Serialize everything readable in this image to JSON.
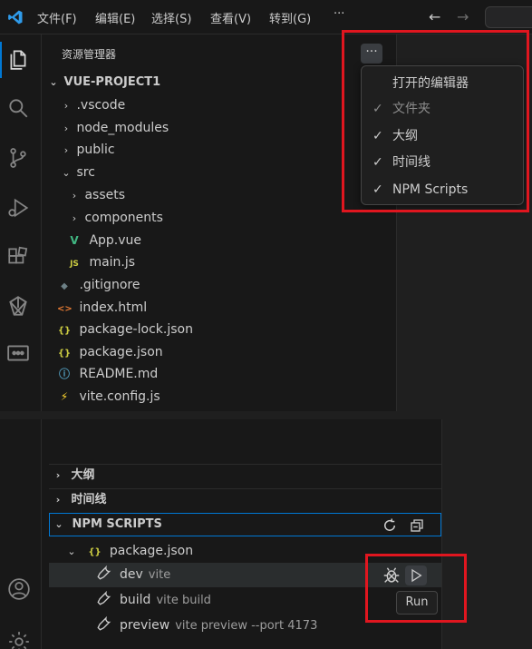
{
  "titlebar": {
    "menu": [
      "文件(F)",
      "编辑(E)",
      "选择(S)",
      "查看(V)",
      "转到(G)"
    ],
    "more": "···",
    "back": "←",
    "forward": "→"
  },
  "explorer": {
    "title": "资源管理器",
    "more": "···",
    "root": "VUE-PROJECT1",
    "items": [
      {
        "label": ".vscode",
        "kind": "folder",
        "expanded": false
      },
      {
        "label": "node_modules",
        "kind": "folder",
        "expanded": false
      },
      {
        "label": "public",
        "kind": "folder",
        "expanded": false
      },
      {
        "label": "src",
        "kind": "folder",
        "expanded": true
      },
      {
        "label": "assets",
        "kind": "folder",
        "expanded": false
      },
      {
        "label": "components",
        "kind": "folder",
        "expanded": false
      },
      {
        "label": "App.vue",
        "kind": "vue",
        "icon": "V"
      },
      {
        "label": "main.js",
        "kind": "js",
        "icon": "JS"
      },
      {
        "label": ".gitignore",
        "kind": "git",
        "icon": "◆"
      },
      {
        "label": "index.html",
        "kind": "html",
        "icon": "<>"
      },
      {
        "label": "package-lock.json",
        "kind": "json",
        "icon": "{}"
      },
      {
        "label": "package.json",
        "kind": "json",
        "icon": "{}"
      },
      {
        "label": "README.md",
        "kind": "info",
        "icon": "ⓘ"
      },
      {
        "label": "vite.config.js",
        "kind": "vite",
        "icon": "⚡"
      }
    ]
  },
  "context_menu": {
    "items": [
      {
        "label": "打开的编辑器",
        "checked": false
      },
      {
        "label": "文件夹",
        "checked": true,
        "dim": true
      },
      {
        "label": "大纲",
        "checked": true
      },
      {
        "label": "时间线",
        "checked": true
      },
      {
        "label": "NPM Scripts",
        "checked": true
      }
    ]
  },
  "lower": {
    "sections": [
      {
        "label": "大纲"
      },
      {
        "label": "时间线"
      },
      {
        "label": "NPM SCRIPTS"
      }
    ],
    "package": "package.json",
    "package_icon": "{}",
    "scripts": [
      {
        "name": "dev",
        "cmd": "vite"
      },
      {
        "name": "build",
        "cmd": "vite build"
      },
      {
        "name": "preview",
        "cmd": "vite preview --port 4173"
      }
    ],
    "tooltip": "Run"
  },
  "colors": {
    "accent": "#0078d4",
    "highlight_box": "#e0161f",
    "vue": "#41b883",
    "js": "#cbcb41",
    "json": "#cbcb41",
    "html": "#e37933",
    "info": "#519aba",
    "vite": "#ffd62e"
  }
}
